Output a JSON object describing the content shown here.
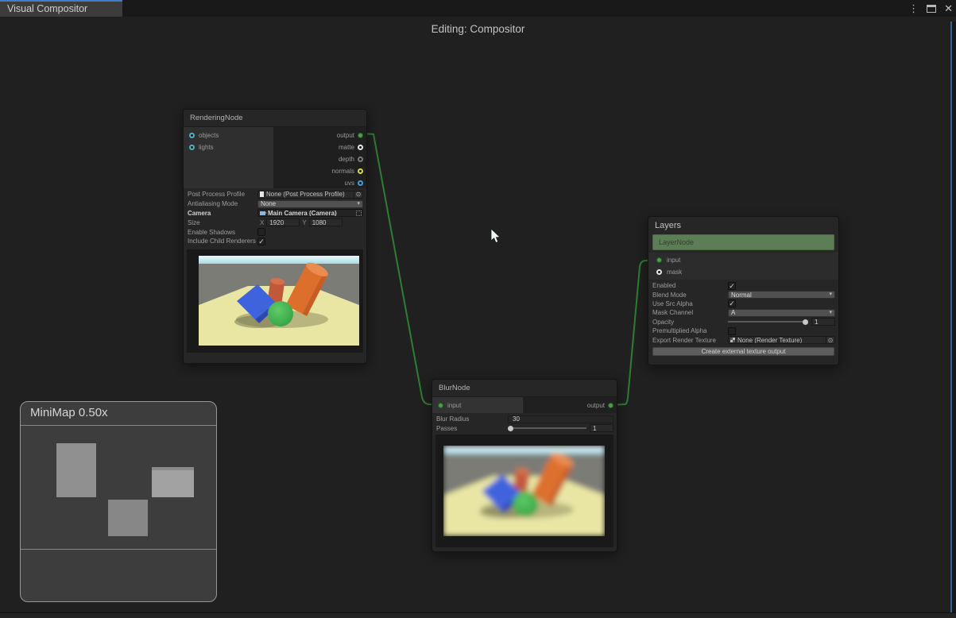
{
  "colors": {
    "accent_blue": "#437dc7",
    "wire_green": "#2e7d32",
    "port_connected": "#4c9e4c",
    "port_object": "#4fb3c4",
    "port_matte": "#e6e6e6",
    "port_depth": "#7d7d7d",
    "port_normals": "#d9d950",
    "port_uvs": "#3f9fdf",
    "layer_green": "#5c7d55"
  },
  "icons": {
    "menu": "⋮",
    "close": "✕",
    "dropdown": "▾",
    "check": "✓",
    "picker": "⊙"
  },
  "window": {
    "tab": "Visual Compositor",
    "editing": "Editing: Compositor"
  },
  "rendering_node": {
    "title": "RenderingNode",
    "inputs": [
      {
        "label": "objects"
      },
      {
        "label": "lights"
      }
    ],
    "outputs": [
      {
        "label": "output"
      },
      {
        "label": "matte"
      },
      {
        "label": "depth"
      },
      {
        "label": "normals"
      },
      {
        "label": "uvs"
      }
    ],
    "props": {
      "post_process": {
        "label": "Post Process Profile",
        "value": "None (Post Process Profile)"
      },
      "aa_mode": {
        "label": "Antialiasing Mode",
        "value": "None"
      },
      "camera": {
        "label": "Camera",
        "value": "Main Camera (Camera)"
      },
      "size": {
        "label": "Size",
        "x_label": "X",
        "x": "1920",
        "y_label": "Y",
        "y": "1080"
      },
      "enable_shadows": {
        "label": "Enable Shadows",
        "checked": false
      },
      "include_child": {
        "label": "Include Child Renderers",
        "checked": true
      }
    }
  },
  "blur_node": {
    "title": "BlurNode",
    "input": "input",
    "output": "output",
    "props": {
      "blur_radius": {
        "label": "Blur Radius",
        "value": "30"
      },
      "passes": {
        "label": "Passes",
        "value": "1"
      }
    }
  },
  "layers_node": {
    "title": "Layers",
    "layer_item": "LayerNode",
    "inputs": [
      {
        "label": "input"
      },
      {
        "label": "mask"
      }
    ],
    "props": {
      "enabled": {
        "label": "Enabled",
        "checked": true
      },
      "blend_mode": {
        "label": "Blend Mode",
        "value": "Normal"
      },
      "use_src_alpha": {
        "label": "Use Src Alpha",
        "checked": true
      },
      "mask_channel": {
        "label": "Mask Channel",
        "value": "A"
      },
      "opacity": {
        "label": "Opacity",
        "value": "1"
      },
      "premultiplied": {
        "label": "Premultiplied Alpha",
        "checked": false
      },
      "export_rt": {
        "label": "Export Render Texture",
        "value": "None (Render Texture)"
      }
    },
    "button": "Create external texture output"
  },
  "minimap": {
    "title": "MiniMap",
    "zoom_level": "0.50x"
  }
}
